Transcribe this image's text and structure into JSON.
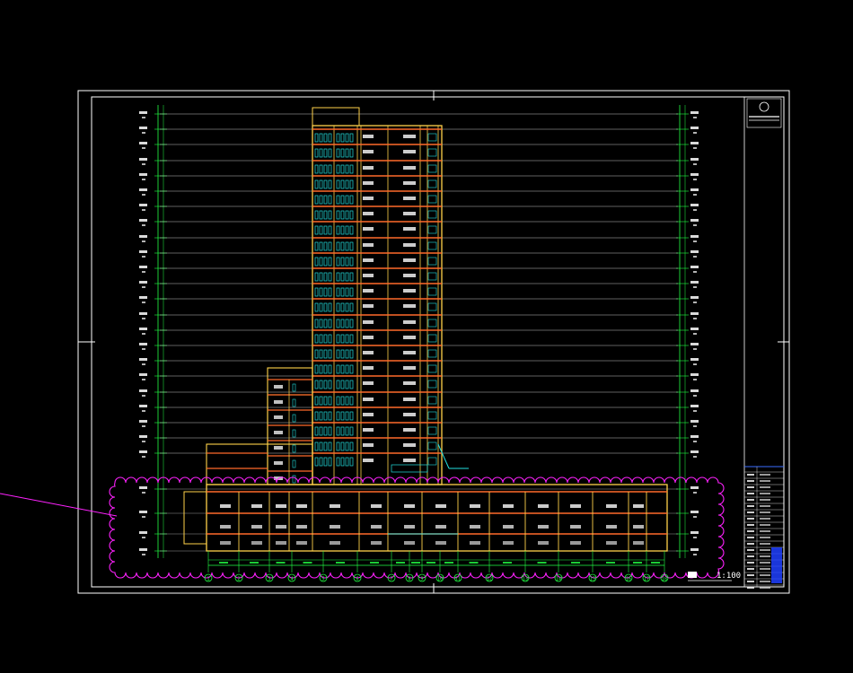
{
  "drawing": {
    "scale_label": "1:100",
    "section_title": "",
    "colors": {
      "background": "#000000",
      "frame": "#ffffff",
      "floor_line": "#ffffff",
      "wall": "#ffd24a",
      "slab": "#ff6a2a",
      "window": "#22e0e0",
      "dimension": "#22ff44",
      "level_tag": "#ffffff",
      "revision_cloud": "#ff22ff",
      "title_block_accent": "#3a6bff"
    },
    "axis_labels": [
      "1",
      "2",
      "3",
      "4",
      "5",
      "6",
      "7",
      "8",
      "9",
      "10",
      "11",
      "12",
      "13",
      "14",
      "15",
      "16",
      "17",
      "18",
      "19",
      "20"
    ]
  }
}
